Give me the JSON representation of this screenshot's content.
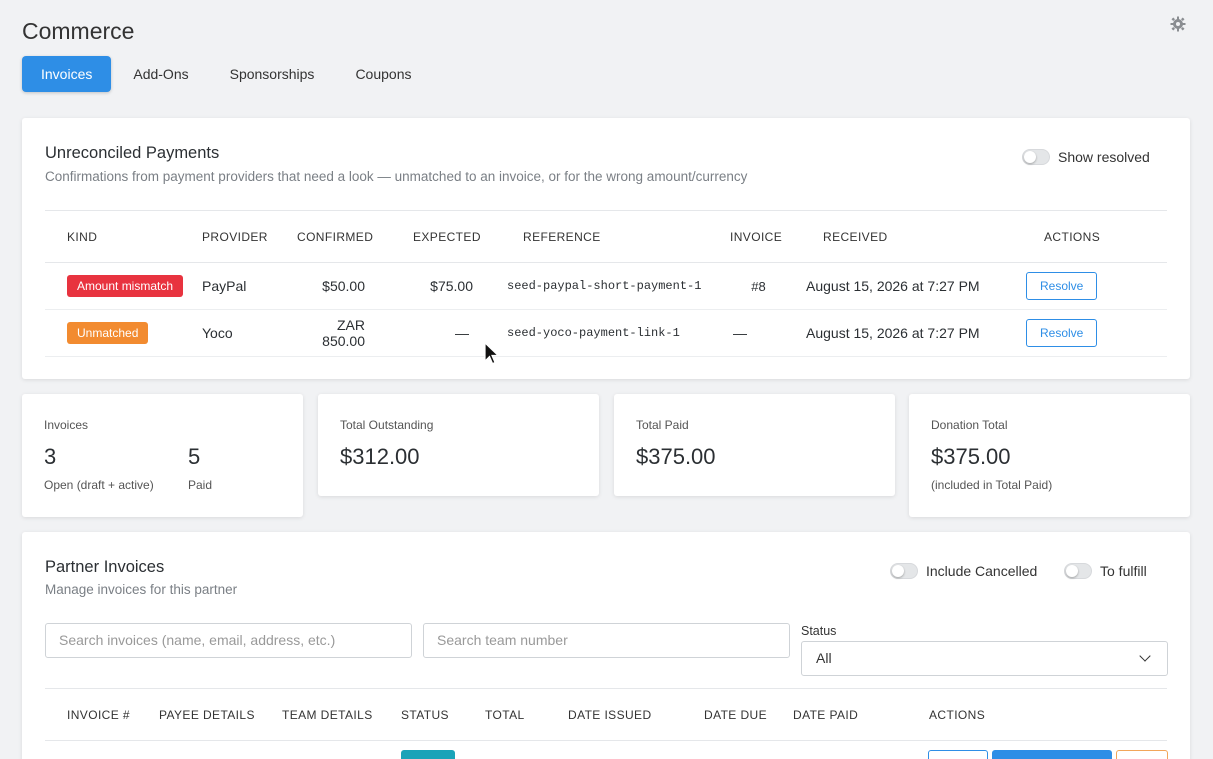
{
  "header": {
    "title": "Commerce",
    "settings_icon": "gear-icon",
    "tabs": [
      {
        "label": "Invoices",
        "active": true
      },
      {
        "label": "Add-Ons",
        "active": false
      },
      {
        "label": "Sponsorships",
        "active": false
      },
      {
        "label": "Coupons",
        "active": false
      }
    ]
  },
  "unreconciled": {
    "title": "Unreconciled Payments",
    "subtitle": "Confirmations from payment providers that need a look — unmatched to an invoice, or for the wrong amount/currency",
    "show_resolved_label": "Show resolved",
    "columns": [
      "KIND",
      "PROVIDER",
      "CONFIRMED",
      "EXPECTED",
      "REFERENCE",
      "INVOICE",
      "RECEIVED",
      "ACTIONS"
    ],
    "rows": [
      {
        "kind": "Amount mismatch",
        "kind_color": "#e8333f",
        "provider": "PayPal",
        "confirmed": "$50.00",
        "expected": "$75.00",
        "reference": "seed-paypal-short-payment-1",
        "invoice": "#8",
        "received": "August 15, 2026 at 7:27 PM",
        "action": "Resolve"
      },
      {
        "kind": "Unmatched",
        "kind_color": "#f28b30",
        "provider": "Yoco",
        "confirmed": "ZAR 850.00",
        "expected": "—",
        "reference": "seed-yoco-payment-link-1",
        "invoice": "—",
        "received": "August 15, 2026 at 7:27 PM",
        "action": "Resolve"
      }
    ]
  },
  "stats": {
    "invoices": {
      "label": "Invoices",
      "open_value": "3",
      "open_label": "Open (draft + active)",
      "paid_value": "5",
      "paid_label": "Paid"
    },
    "outstanding": {
      "label": "Total Outstanding",
      "value": "$312.00"
    },
    "paid": {
      "label": "Total Paid",
      "value": "$375.00"
    },
    "donation": {
      "label": "Donation Total",
      "value": "$375.00",
      "note": "(included in Total Paid)"
    }
  },
  "partner": {
    "title": "Partner Invoices",
    "subtitle": "Manage invoices for this partner",
    "include_cancelled_label": "Include Cancelled",
    "to_fulfill_label": "To fulfill",
    "search_placeholder": "Search invoices (name, email, address, etc.)",
    "team_placeholder": "Search team number",
    "status_label": "Status",
    "status_value": "All",
    "columns": [
      "INVOICE #",
      "PAYEE DETAILS",
      "TEAM DETAILS",
      "STATUS",
      "TOTAL",
      "DATE ISSUED",
      "DATE DUE",
      "DATE PAID",
      "ACTIONS"
    ]
  }
}
